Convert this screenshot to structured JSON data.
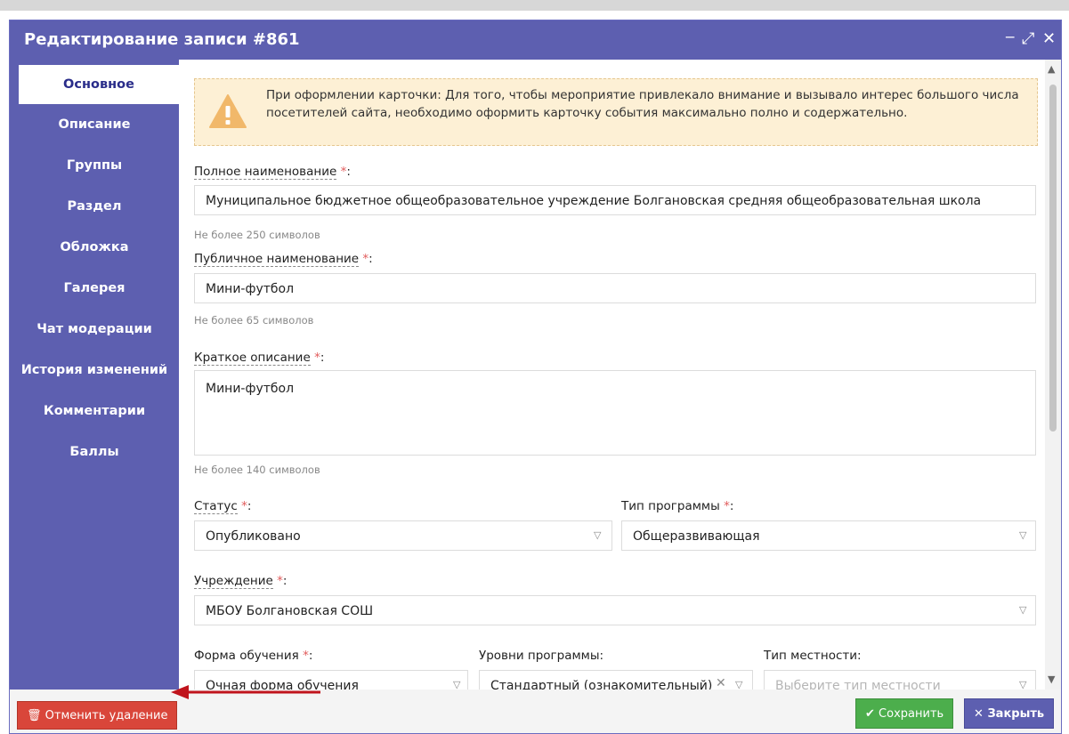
{
  "window": {
    "title": "Редактирование записи #861",
    "minimize_glyph": "‒",
    "maximize_glyph": "⤢",
    "close_glyph": "✕"
  },
  "sidebar": {
    "items": [
      {
        "label": "Основное",
        "active": true
      },
      {
        "label": "Описание"
      },
      {
        "label": "Группы"
      },
      {
        "label": "Раздел"
      },
      {
        "label": "Обложка"
      },
      {
        "label": "Галерея"
      },
      {
        "label": "Чат модерации"
      },
      {
        "label": "История изменений"
      },
      {
        "label": "Комментарии"
      },
      {
        "label": "Баллы"
      }
    ]
  },
  "alert": {
    "icon": "warning-icon",
    "text": "При оформлении карточки: Для того, чтобы мероприятие привлекало внимание и вызывало интерес большого числа посетителей сайта, необходимо оформить карточку события максимально полно и содержательно."
  },
  "form": {
    "required_mark": "*",
    "full_name": {
      "label": "Полное наименование",
      "value": "Муниципальное бюджетное общеобразовательное учреждение Болгановская средняя общеобразовательная школа",
      "hint": "Не более 250 символов"
    },
    "public_name": {
      "label": "Публичное наименование",
      "value": "Мини-футбол",
      "hint": "Не более 65 символов"
    },
    "short_desc": {
      "label": "Краткое описание",
      "value": "Мини-футбол",
      "hint": "Не более 140 символов"
    },
    "status": {
      "label": "Статус",
      "value": "Опубликовано"
    },
    "program_type": {
      "label": "Тип программы",
      "value": "Общеразвивающая"
    },
    "institution": {
      "label": "Учреждение",
      "value": "МБОУ Болгановская СОШ"
    },
    "study_form": {
      "label": "Форма обучения",
      "value": "Очная форма обучения"
    },
    "program_levels": {
      "label": "Уровни программы:",
      "value": "Стандартный (ознакомительный)"
    },
    "locality_type": {
      "label": "Тип местности:",
      "placeholder": "Выберите тип местности"
    }
  },
  "footer": {
    "cancel_delete": "Отменить удаление",
    "save": "Сохранить",
    "close": "Закрыть"
  },
  "colors": {
    "accent": "#5d5fb0",
    "danger": "#d9463a",
    "success": "#4cae4c",
    "warning_bg": "#fdf0d5"
  }
}
